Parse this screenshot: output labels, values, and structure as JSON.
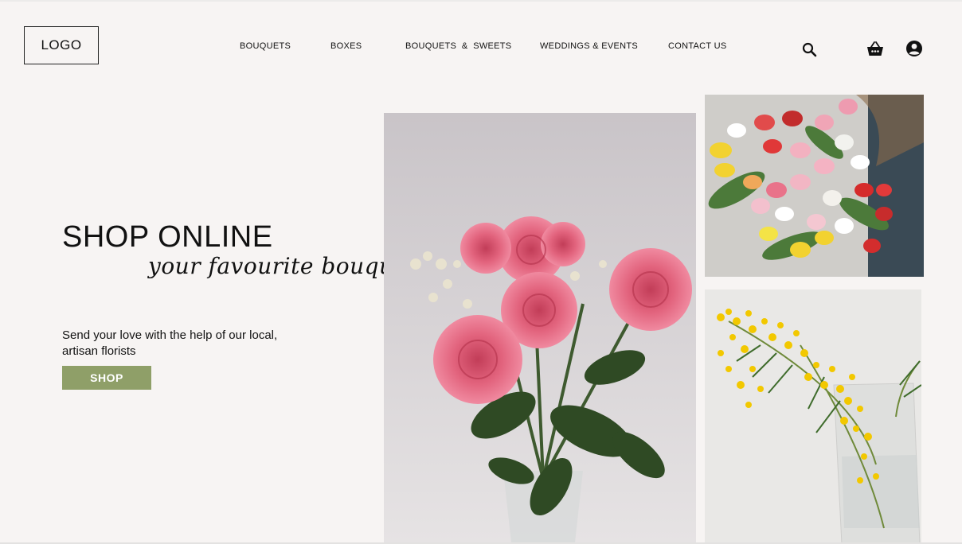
{
  "header": {
    "logo": "LOGO",
    "nav": [
      {
        "label": "BOUQUETS"
      },
      {
        "label": "BOXES"
      },
      {
        "label": "BOUQUETS  &  SWEETS"
      },
      {
        "label": "WEDDINGS & EVENTS"
      },
      {
        "label": "CONTACT US"
      }
    ],
    "icons": [
      "search-icon",
      "basket-icon",
      "user-account-icon"
    ]
  },
  "hero": {
    "title": "SHOP ONLINE",
    "subtitle": "your favourite bouquets",
    "description_line1": "Send your love with the help of our local,",
    "description_line2": "artisan florists",
    "cta_label": "SHOP"
  },
  "gallery": {
    "images": [
      "pink-roses-bouquet",
      "tulips-bouquet",
      "mimosa-in-vase"
    ]
  },
  "colors": {
    "background": "#f7f4f3",
    "accent": "#8f9f68",
    "text": "#111111"
  }
}
